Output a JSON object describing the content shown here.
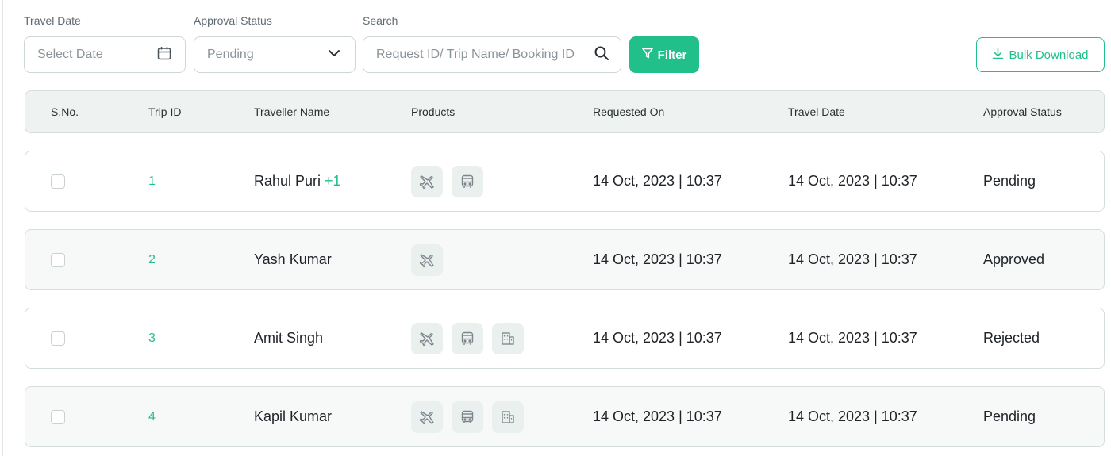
{
  "filters": {
    "travel_date": {
      "label": "Travel Date",
      "placeholder": "Select Date"
    },
    "approval_status": {
      "label": "Approval Status",
      "value": "Pending"
    },
    "search": {
      "label": "Search",
      "placeholder": "Request ID/ Trip Name/ Booking ID"
    },
    "filter_button": "Filter",
    "bulk_download_button": "Bulk Download"
  },
  "colors": {
    "accent": "#21c08b",
    "header_bg": "#eef3f1",
    "icon_bg": "#eaf0ee"
  },
  "table": {
    "headers": [
      "S.No.",
      "Trip ID",
      "Traveller Name",
      "Products",
      "Requested On",
      "Travel Date",
      "Approval Status"
    ],
    "rows": [
      {
        "trip_id": "1",
        "traveller": "Rahul Puri",
        "extra": "+1",
        "products": [
          "flight-icon",
          "bus-icon"
        ],
        "requested_on": "14 Oct, 2023 | 10:37",
        "travel_date": "14 Oct, 2023 | 10:37",
        "status": "Pending"
      },
      {
        "trip_id": "2",
        "traveller": "Yash Kumar",
        "extra": "",
        "products": [
          "flight-icon"
        ],
        "requested_on": "14 Oct, 2023 | 10:37",
        "travel_date": "14 Oct, 2023 | 10:37",
        "status": "Approved"
      },
      {
        "trip_id": "3",
        "traveller": "Amit Singh",
        "extra": "",
        "products": [
          "flight-icon",
          "bus-icon",
          "hotel-icon"
        ],
        "requested_on": "14 Oct, 2023 | 10:37",
        "travel_date": "14 Oct, 2023 | 10:37",
        "status": "Rejected"
      },
      {
        "trip_id": "4",
        "traveller": "Kapil Kumar",
        "extra": "",
        "products": [
          "flight-icon",
          "bus-icon",
          "hotel-icon"
        ],
        "requested_on": "14 Oct, 2023 | 10:37",
        "travel_date": "14 Oct, 2023 | 10:37",
        "status": "Pending"
      }
    ]
  }
}
